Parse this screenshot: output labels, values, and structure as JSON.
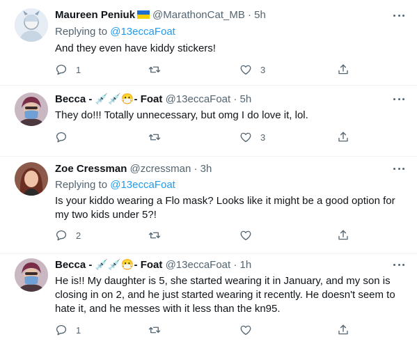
{
  "tweets": [
    {
      "name": "Maureen Peniuk",
      "flag": "Ukraine flag",
      "handle": "@MarathonCat_MB",
      "time": "· 5h",
      "reply_prefix": "Replying to ",
      "reply_to": "@13eccaFoat",
      "text": "And they even have kiddy stickers!",
      "replies": "1",
      "retweets": "",
      "likes": "3"
    },
    {
      "name": "Becca - 💉💉😷- Foat",
      "handle": "@13eccaFoat",
      "time": "· 5h",
      "text": "They do!!! Totally unnecessary, but omg I do love it, lol.",
      "replies": "",
      "retweets": "",
      "likes": "3"
    },
    {
      "name": "Zoe Cressman",
      "handle": "@zcressman",
      "time": "· 3h",
      "reply_prefix": "Replying to ",
      "reply_to": "@13eccaFoat",
      "text_line1": "Is your kiddo wearing a Flo mask? Looks like it might be a good option for",
      "text_line2": "my two kids under 5?!",
      "replies": "2",
      "retweets": "",
      "likes": ""
    },
    {
      "name": "Becca - 💉💉😷- Foat",
      "handle": "@13eccaFoat",
      "time": "· 1h",
      "text_line1": "He is!! My daughter is 5, she started wearing it in January, and my son is",
      "text_line2": "closing in on 2, and he just started wearing it recently. He doesn't seem to",
      "text_line3": "hate it, and he messes with it less than the kn95.",
      "replies": "1",
      "retweets": "",
      "likes": ""
    }
  ],
  "icons": {
    "reply": "reply-icon",
    "retweet": "retweet-icon",
    "like": "heart-icon",
    "share": "share-icon",
    "more": "more-icon"
  },
  "colors": {
    "link": "#1d9bf0",
    "muted": "#536471",
    "text": "#0f1419"
  }
}
